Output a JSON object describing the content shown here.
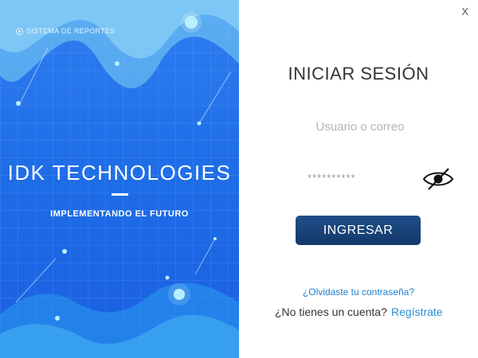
{
  "window": {
    "close_label": "X"
  },
  "left_panel": {
    "brand": "SISTEMA DE REPORTES",
    "company": "IDK TECHNOLOGIES",
    "tagline": "IMPLEMENTANDO EL FUTURO",
    "background_color": "#1f6ee8"
  },
  "login": {
    "title": "INICIAR SESIÓN",
    "username_placeholder": "Usuario o correo",
    "password_value": "**********",
    "toggle_icon": "eye-off-icon",
    "submit_label": "INGRESAR",
    "submit_color": "#14386a",
    "forgot_link": "¿Olvidaste tu contraseña?",
    "no_account_text": "¿No tienes un cuenta?",
    "register_link": "Regístrate",
    "link_color": "#1f7fcf"
  }
}
